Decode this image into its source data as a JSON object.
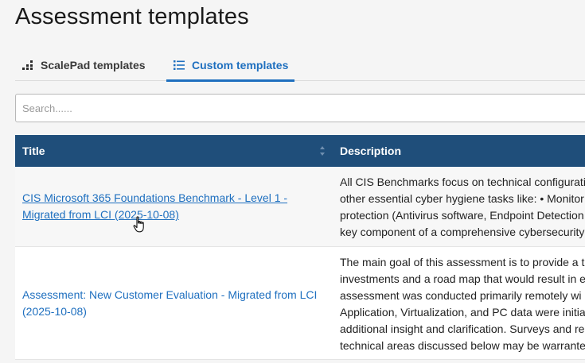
{
  "page": {
    "title": "Assessment templates"
  },
  "tabs": [
    {
      "label": "ScalePad templates",
      "icon": "bar-chart-icon",
      "active": false
    },
    {
      "label": "Custom templates",
      "icon": "list-icon",
      "active": true
    }
  ],
  "search": {
    "placeholder": "Search......",
    "value": ""
  },
  "colors": {
    "header_bg": "#1f4e7a",
    "accent": "#1e6fbf"
  },
  "table": {
    "columns": [
      "Title",
      "Description"
    ],
    "rows": [
      {
        "title": "CIS Microsoft 365 Foundations Benchmark - Level 1 - Migrated from LCI (2025-10-08)",
        "description_lines": [
          "All CIS Benchmarks focus on technical configurati",
          "other essential cyber hygiene tasks like: • Monitor",
          "protection (Antivirus software, Endpoint Detection",
          "key component of a comprehensive cybersecurity"
        ]
      },
      {
        "title": "Assessment: New Customer Evaluation - Migrated from LCI (2025-10-08)",
        "description_lines": [
          "The main goal of this assessment is to provide a t",
          "investments and a road map that would result in e",
          "assessment was conducted primarily remotely wi",
          "Application, Virtualization, and PC data were initia",
          "additional insight and clarification. Surveys and re",
          "technical areas discussed below may be warrante"
        ]
      }
    ]
  }
}
